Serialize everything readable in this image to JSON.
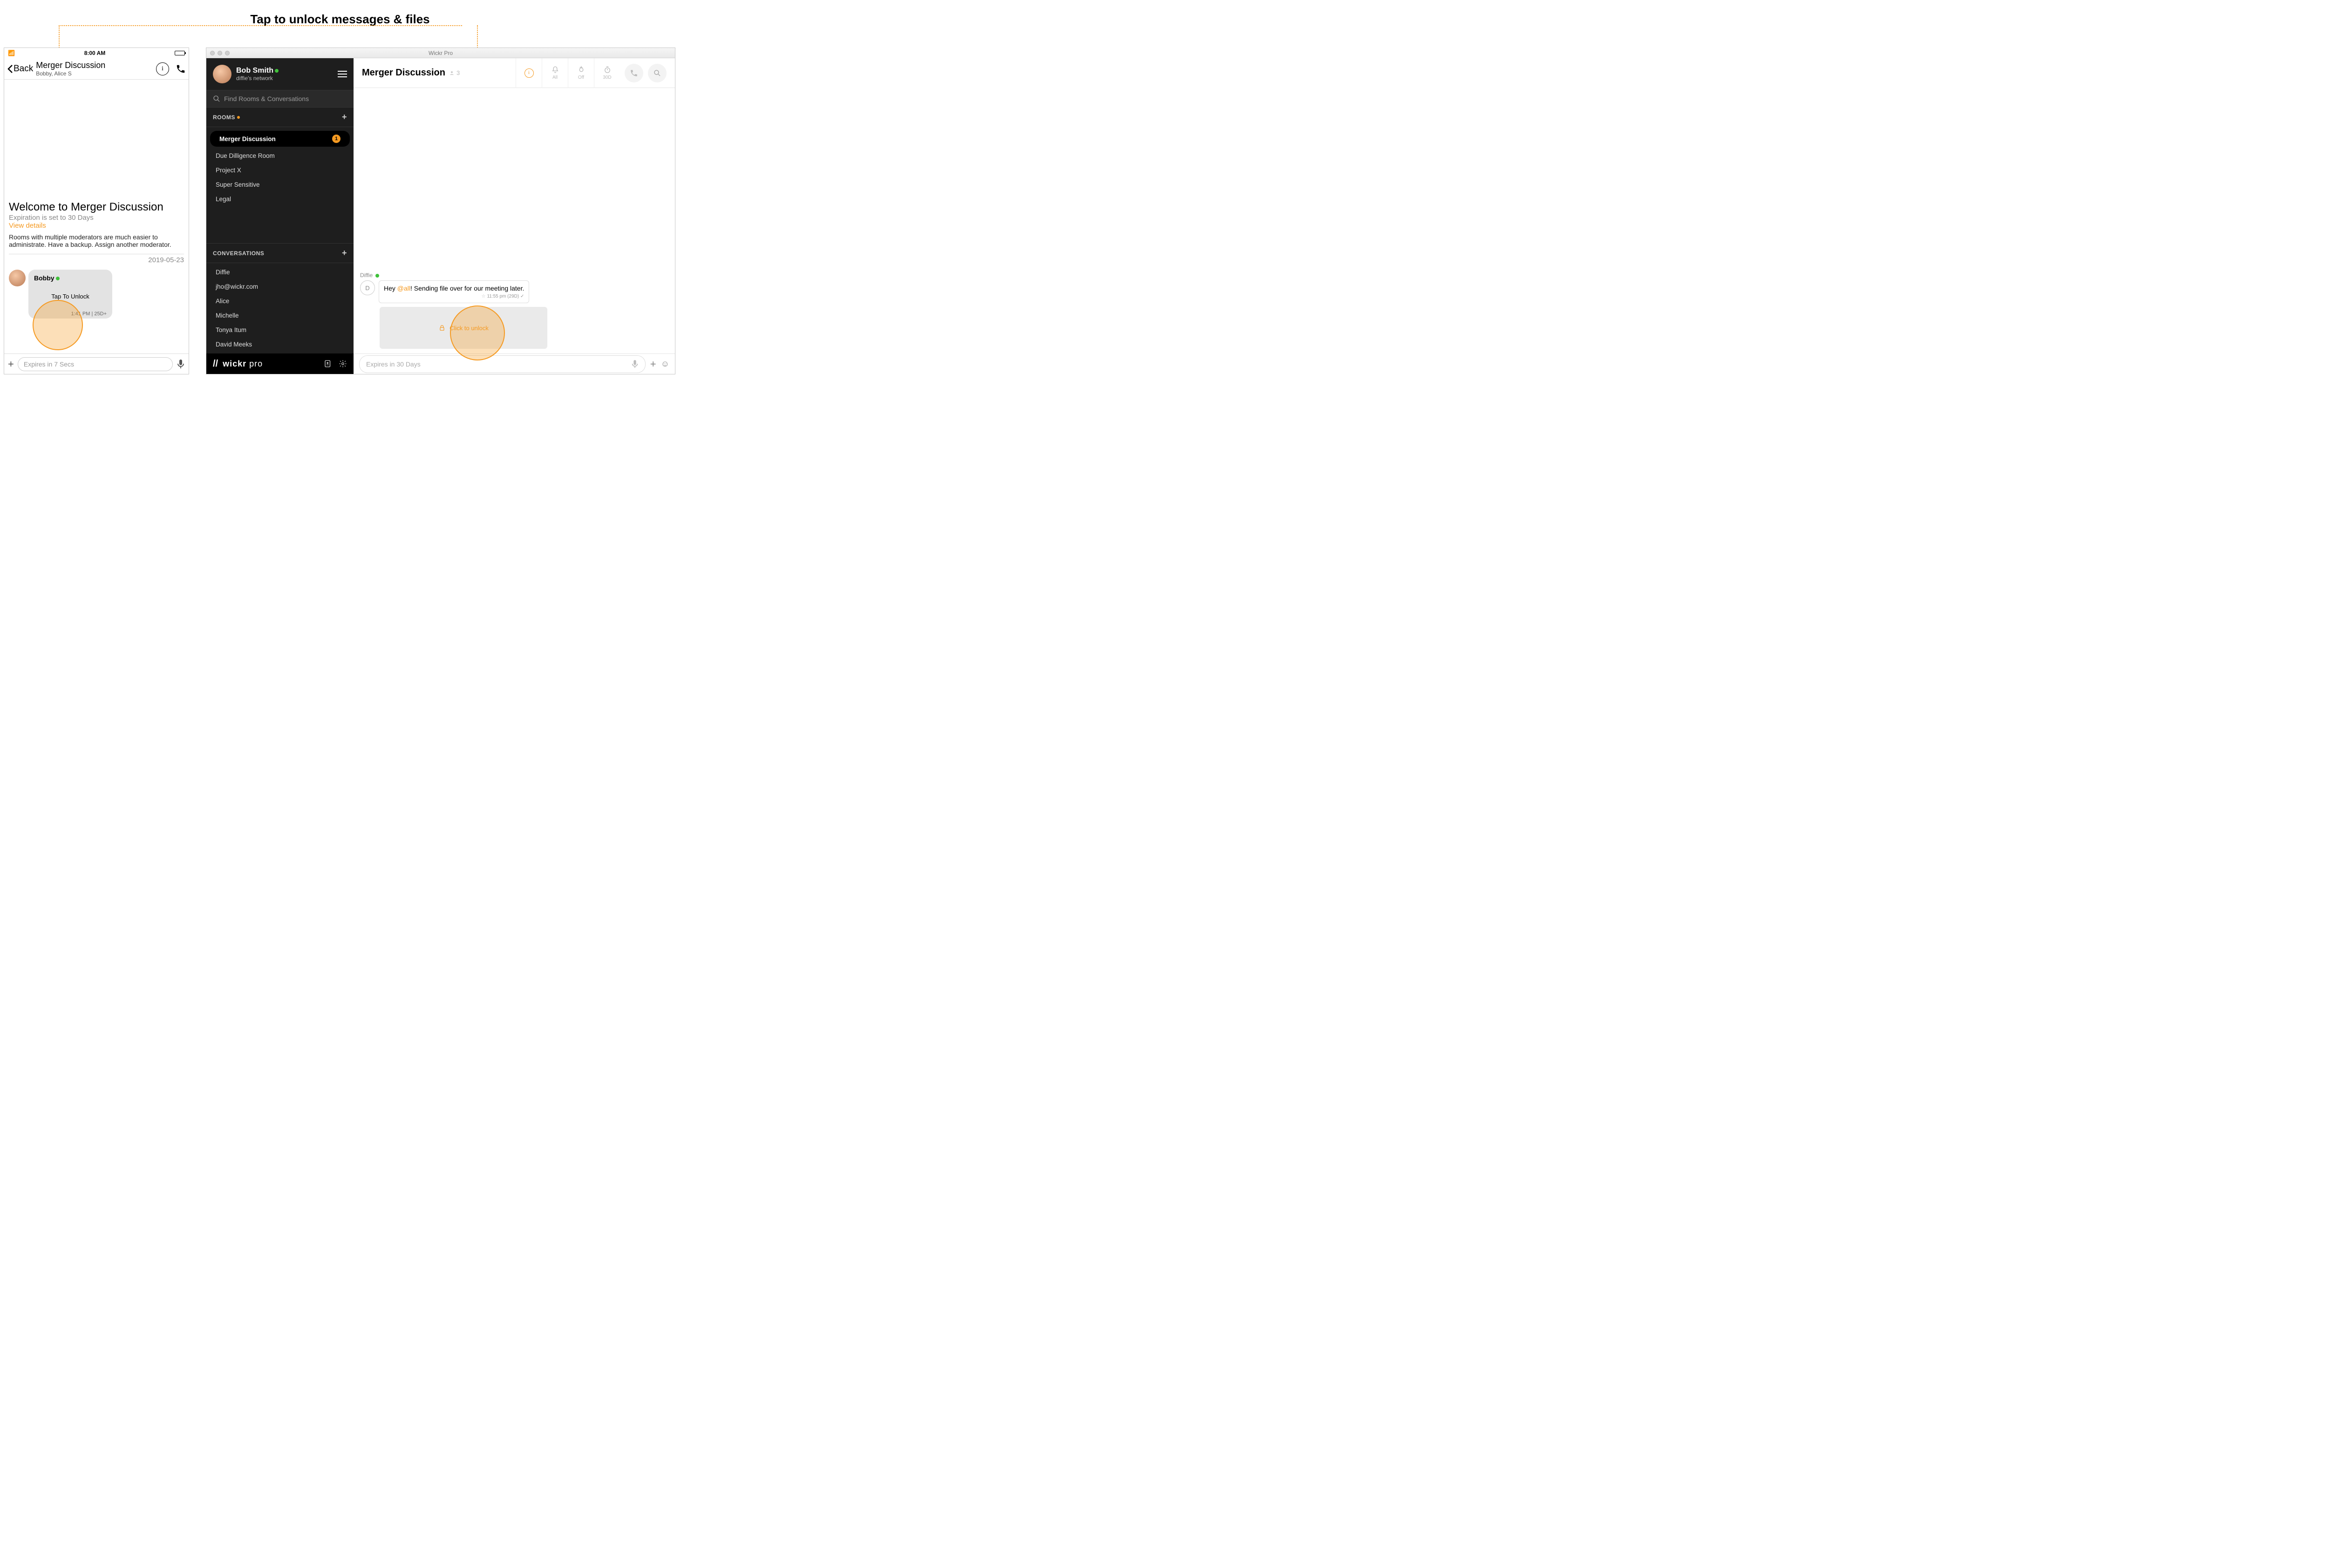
{
  "title": "Tap to unlock messages & files",
  "mobile": {
    "status": {
      "time": "8:00 AM"
    },
    "header": {
      "back": "Back",
      "title": "Merger Discussion",
      "subtitle": "Bobby, Alice S"
    },
    "welcome": {
      "heading": "Welcome to Merger Discussion",
      "sub": "Expiration is set to 30 Days",
      "link": "View details",
      "tip": "Rooms with multiple moderators are much easier to administrate. Have a backup. Assign another moderator."
    },
    "date": "2019-05-23",
    "message": {
      "sender": "Bobby",
      "unlock": "Tap To Unlock",
      "meta": "1:41 PM | 25D+"
    },
    "compose": {
      "placeholder": "Expires in 7 Secs"
    }
  },
  "desktop": {
    "window_title": "Wickr Pro",
    "user": {
      "name": "Bob Smith",
      "network": "diffie's network"
    },
    "search_placeholder": "Find Rooms & Conversations",
    "rooms_label": "ROOMS",
    "rooms": [
      {
        "label": "Merger Discussion",
        "badge": "1",
        "active": true
      },
      {
        "label": "Due Dilligence Room"
      },
      {
        "label": "Project X"
      },
      {
        "label": "Super Sensitive"
      },
      {
        "label": "Legal"
      }
    ],
    "conversations_label": "CONVERSATIONS",
    "conversations": [
      {
        "label": "Diffie"
      },
      {
        "label": "jho@wickr.com"
      },
      {
        "label": "Alice"
      },
      {
        "label": "Michelle"
      },
      {
        "label": "Tonya Itum"
      },
      {
        "label": "David Meeks"
      }
    ],
    "footer_brand_bold": "wickr",
    "footer_brand_light": " pro",
    "chat": {
      "title": "Merger Discussion",
      "members": "3",
      "toolbar": {
        "all": "All",
        "off": "Off",
        "thirty": "30D"
      },
      "sender": "Diffie",
      "avatar_letter": "D",
      "text_pre": "Hey ",
      "mention": "@all",
      "text_post": "! Sending file over for our meeting later.",
      "meta": "11:55 pm (29D)",
      "unlock": "Click to unlock",
      "compose_placeholder": "Expires in 30 Days"
    }
  }
}
